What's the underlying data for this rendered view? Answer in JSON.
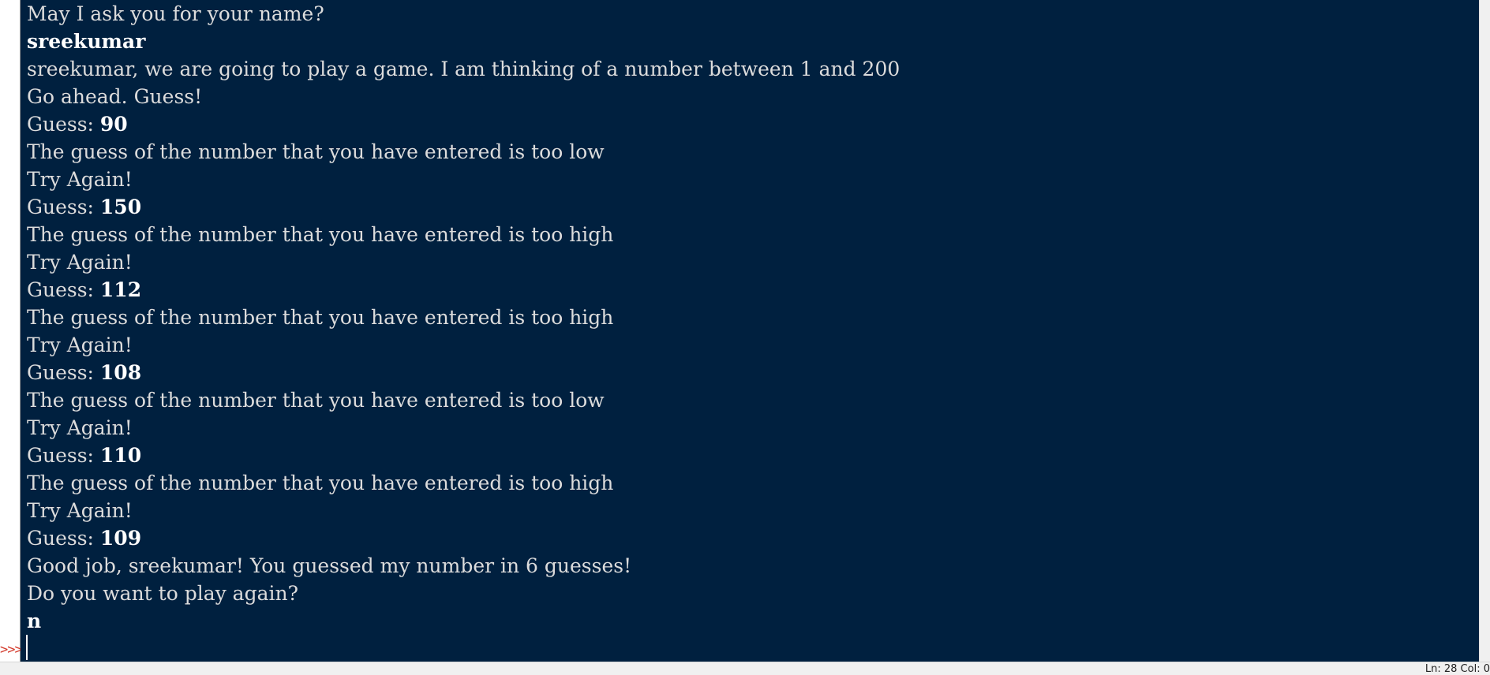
{
  "shell": {
    "prompt": ">>>",
    "lines": [
      {
        "kind": "output",
        "text": "May I ask you for your name?"
      },
      {
        "kind": "input",
        "text": "sreekumar"
      },
      {
        "kind": "output",
        "text": "sreekumar, we are going to play a game. I am thinking of a number between 1 and 200"
      },
      {
        "kind": "output",
        "text": "Go ahead. Guess!"
      },
      {
        "kind": "guess",
        "prompt": "Guess: ",
        "value": "90"
      },
      {
        "kind": "output",
        "text": "The guess of the number that you have entered is too low"
      },
      {
        "kind": "output",
        "text": "Try Again!"
      },
      {
        "kind": "guess",
        "prompt": "Guess: ",
        "value": "150"
      },
      {
        "kind": "output",
        "text": "The guess of the number that you have entered is too high"
      },
      {
        "kind": "output",
        "text": "Try Again!"
      },
      {
        "kind": "guess",
        "prompt": "Guess: ",
        "value": "112"
      },
      {
        "kind": "output",
        "text": "The guess of the number that you have entered is too high"
      },
      {
        "kind": "output",
        "text": "Try Again!"
      },
      {
        "kind": "guess",
        "prompt": "Guess: ",
        "value": "108"
      },
      {
        "kind": "output",
        "text": "The guess of the number that you have entered is too low"
      },
      {
        "kind": "output",
        "text": "Try Again!"
      },
      {
        "kind": "guess",
        "prompt": "Guess: ",
        "value": "110"
      },
      {
        "kind": "output",
        "text": "The guess of the number that you have entered is too high"
      },
      {
        "kind": "output",
        "text": "Try Again!"
      },
      {
        "kind": "guess",
        "prompt": "Guess: ",
        "value": "109"
      },
      {
        "kind": "output",
        "text": "Good job, sreekumar! You guessed my number in 6 guesses!"
      },
      {
        "kind": "output",
        "text": "Do you want to play again?"
      },
      {
        "kind": "input",
        "text": "n"
      }
    ]
  },
  "status": {
    "text": "Ln: 28   Col: 0"
  },
  "colors": {
    "console_background": "#00203f",
    "output_text": "#dcdcdc",
    "input_text": "#ffffff",
    "prompt_marker": "#d33a2c"
  }
}
